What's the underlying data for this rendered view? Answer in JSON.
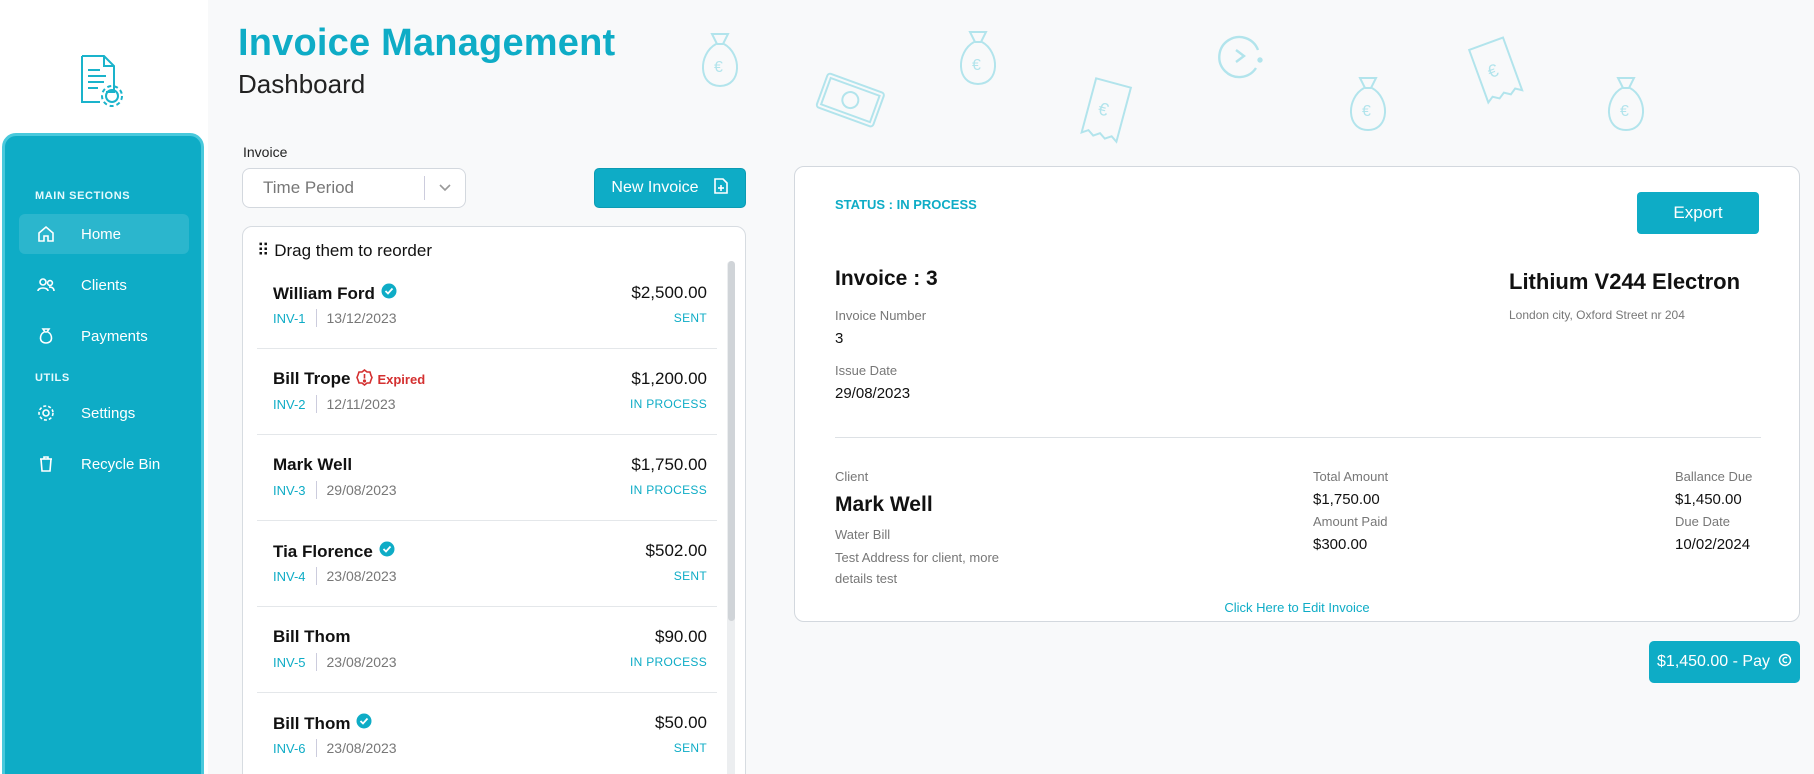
{
  "app": {
    "title": "Invoice Management",
    "subtitle": "Dashboard"
  },
  "sidebar": {
    "sections": {
      "main": "MAIN SECTIONS",
      "utils": "UTILS"
    },
    "items": [
      {
        "label": "Home",
        "icon": "home-icon"
      },
      {
        "label": "Clients",
        "icon": "clients-icon"
      },
      {
        "label": "Payments",
        "icon": "money-bag-icon"
      },
      {
        "label": "Settings",
        "icon": "gear-icon"
      },
      {
        "label": "Recycle Bin",
        "icon": "trash-icon"
      }
    ]
  },
  "filter": {
    "label": "Invoice",
    "placeholder": "Time Period"
  },
  "toolbar": {
    "new_invoice_label": "New Invoice"
  },
  "list": {
    "drag_hint": "Drag them to reorder",
    "rows": [
      {
        "name": "William Ford",
        "verified": true,
        "badge": "",
        "inv": "INV-1",
        "date": "13/12/2023",
        "amount": "$2,500.00",
        "status": "SENT"
      },
      {
        "name": "Bill Trope",
        "verified": false,
        "badge": "Expired",
        "inv": "INV-2",
        "date": "12/11/2023",
        "amount": "$1,200.00",
        "status": "IN PROCESS"
      },
      {
        "name": "Mark Well",
        "verified": false,
        "badge": "",
        "inv": "INV-3",
        "date": "29/08/2023",
        "amount": "$1,750.00",
        "status": "IN PROCESS"
      },
      {
        "name": "Tia Florence",
        "verified": true,
        "badge": "",
        "inv": "INV-4",
        "date": "23/08/2023",
        "amount": "$502.00",
        "status": "SENT"
      },
      {
        "name": "Bill Thom",
        "verified": false,
        "badge": "",
        "inv": "INV-5",
        "date": "23/08/2023",
        "amount": "$90.00",
        "status": "IN PROCESS"
      },
      {
        "name": "Bill Thom",
        "verified": true,
        "badge": "",
        "inv": "INV-6",
        "date": "23/08/2023",
        "amount": "$50.00",
        "status": "SENT"
      }
    ]
  },
  "detail": {
    "status": "STATUS : IN PROCESS",
    "export_label": "Export",
    "invoice_title": "Invoice : 3",
    "invoice_number_label": "Invoice Number",
    "invoice_number": "3",
    "issue_date_label": "Issue Date",
    "issue_date": "29/08/2023",
    "company_name": "Lithium V244 Electron",
    "company_address": "London city, Oxford Street nr 204",
    "client_label": "Client",
    "client_name": "Mark Well",
    "bill_note": "Water Bill",
    "client_address": "Test Address for client, more details test",
    "total_amount_label": "Total Amount",
    "total_amount": "$1,750.00",
    "amount_paid_label": "Amount Paid",
    "amount_paid": "$300.00",
    "balance_due_label": "Ballance Due",
    "balance_due": "$1,450.00",
    "due_date_label": "Due Date",
    "due_date": "10/02/2024",
    "edit_link": "Click Here to Edit Invoice"
  },
  "pay": {
    "label": "$1,450.00 - Pay"
  },
  "colors": {
    "accent": "#0eacc6",
    "expired": "#d43030"
  }
}
